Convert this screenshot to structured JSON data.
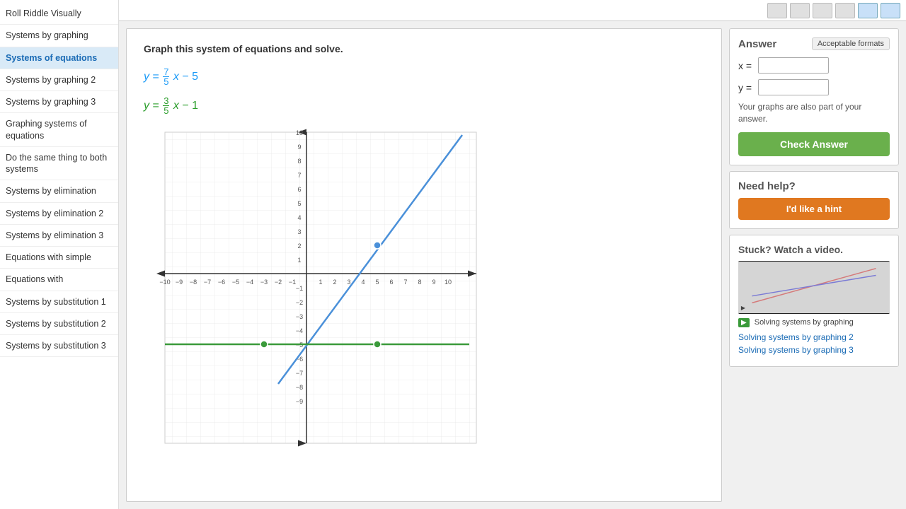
{
  "sidebar": {
    "items": [
      {
        "label": "Roll Riddle Visually",
        "active": false
      },
      {
        "label": "Systems by graphing",
        "active": false
      },
      {
        "label": "Systems of equations",
        "active": true
      },
      {
        "label": "Systems by graphing 2",
        "active": false
      },
      {
        "label": "Systems by graphing 3",
        "active": false
      },
      {
        "label": "Graphing systems of equations",
        "active": false
      },
      {
        "label": "Do the same thing to both systems",
        "active": false
      },
      {
        "label": "Systems by elimination",
        "active": false
      },
      {
        "label": "Systems by elimination 2",
        "active": false
      },
      {
        "label": "Systems by elimination 3",
        "active": false
      },
      {
        "label": "Equations with simple",
        "active": false
      },
      {
        "label": "Equations with",
        "active": false
      },
      {
        "label": "Systems by substitution 1",
        "active": false
      },
      {
        "label": "Systems by substitution 2",
        "active": false
      },
      {
        "label": "Systems by substitution 3",
        "active": false
      }
    ]
  },
  "exercise": {
    "instruction": "Graph this system of equations and solve.",
    "eq1_text": "y = 7/5 x − 5",
    "eq2_text": "y = 3/5 x − 1"
  },
  "answer_panel": {
    "title": "Answer",
    "acceptable_formats": "Acceptable formats",
    "x_label": "x =",
    "y_label": "y =",
    "x_value": "",
    "y_value": "",
    "note": "Your graphs are also part of your answer.",
    "check_button": "Check Answer"
  },
  "help_panel": {
    "title": "Need help?",
    "hint_button": "I'd like a hint"
  },
  "video_panel": {
    "title": "Stuck? Watch a video.",
    "video_label": "Solving systems by graphing",
    "related_links": [
      "Solving systems by graphing 2",
      "Solving systems by graphing 3"
    ]
  },
  "graph": {
    "x_min": -10,
    "x_max": 10,
    "y_min": -10,
    "y_max": 10,
    "grid_step": 1
  }
}
